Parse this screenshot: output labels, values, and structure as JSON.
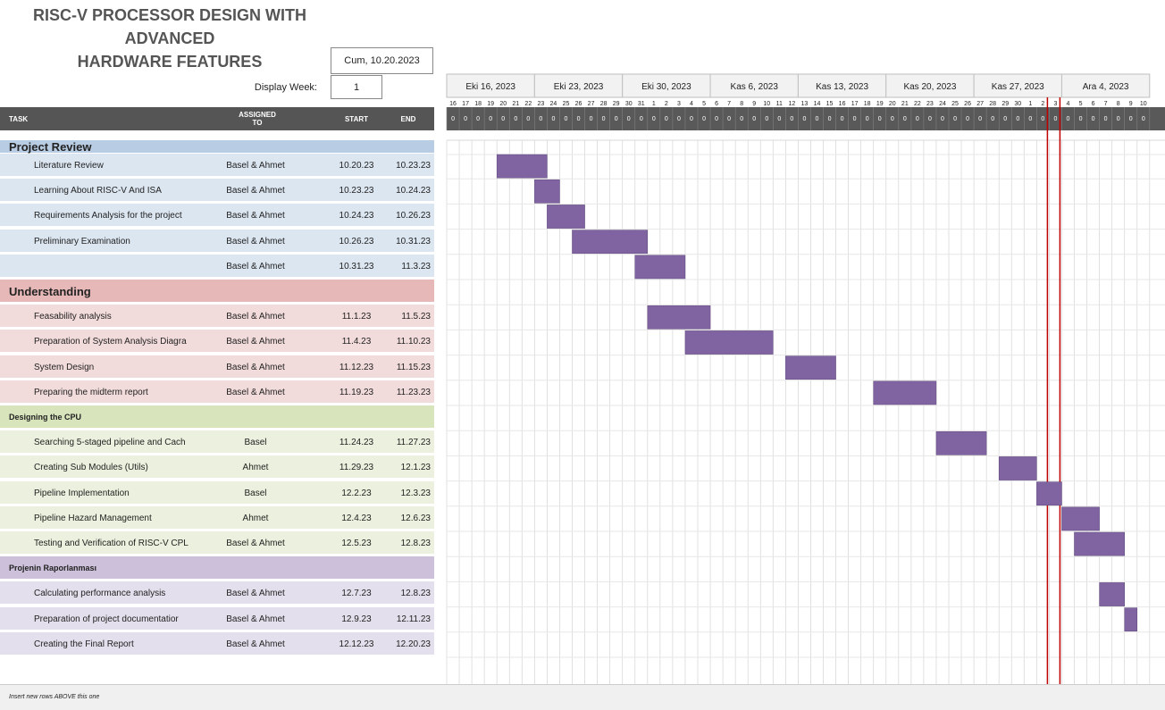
{
  "title": {
    "line1": "RISC-V PROCESSOR DESIGN WITH",
    "line2": "ADVANCED",
    "line3": "HARDWARE FEATURES"
  },
  "project_start": "Cum, 10.20.2023",
  "display_week": {
    "label": "Display Week:",
    "value": "1"
  },
  "headers": {
    "task": "TASK",
    "assigned_line1": "ASSIGNED",
    "assigned_line2": "TO",
    "start": "START",
    "end": "END"
  },
  "timeline": {
    "weeks": [
      "Eki 16, 2023",
      "Eki 23, 2023",
      "Eki 30, 2023",
      "Kas 6, 2023",
      "Kas 13, 2023",
      "Kas 20, 2023",
      "Kas 27, 2023",
      "Ara 4, 2023"
    ],
    "days": [
      "16",
      "17",
      "18",
      "19",
      "20",
      "21",
      "22",
      "23",
      "24",
      "25",
      "26",
      "27",
      "28",
      "29",
      "30",
      "31",
      "1",
      "2",
      "3",
      "4",
      "5",
      "6",
      "7",
      "8",
      "9",
      "10",
      "11",
      "12",
      "13",
      "14",
      "15",
      "16",
      "17",
      "18",
      "19",
      "20",
      "21",
      "22",
      "23",
      "24",
      "25",
      "26",
      "27",
      "28",
      "29",
      "30",
      "1",
      "2",
      "3",
      "4",
      "5",
      "6",
      "7",
      "8",
      "9",
      "10"
    ],
    "zero": "0",
    "today_markers": [
      3,
      4
    ]
  },
  "colors": {
    "bar": "#8064a2",
    "review_head": "#b8cce4",
    "review_row": "#dce6f1",
    "understanding_head": "#e6b8b7",
    "understanding_row": "#f2dcdb",
    "cpu_head": "#d8e4bc",
    "cpu_row": "#ebf1de",
    "report_head": "#ccc0da",
    "report_row": "#e4dfec",
    "today_line": "#c00000"
  },
  "sections": [
    {
      "name": "Project Review",
      "size": "big",
      "head_color": "review_head",
      "row_color": "review_row",
      "tasks": [
        {
          "task": "Literature Review",
          "assigned": "Basel & Ahmet",
          "start": "10.20.23",
          "end": "10.23.23",
          "bar": [
            4,
            8
          ]
        },
        {
          "task": "Learning About RISC-V And ISA",
          "assigned": "Basel & Ahmet",
          "start": "10.23.23",
          "end": "10.24.23",
          "bar": [
            7,
            9
          ]
        },
        {
          "task": "Requirements Analysis for the project",
          "assigned": "Basel & Ahmet",
          "start": "10.24.23",
          "end": "10.26.23",
          "bar": [
            8,
            11
          ]
        },
        {
          "task": "Preliminary Examination",
          "assigned": "Basel & Ahmet",
          "start": "10.26.23",
          "end": "10.31.23",
          "bar": [
            10,
            16
          ]
        },
        {
          "task": "",
          "assigned": "Basel & Ahmet",
          "start": "10.31.23",
          "end": "11.3.23",
          "bar": [
            15,
            19
          ]
        }
      ]
    },
    {
      "name": "Understanding",
      "size": "medium",
      "head_color": "understanding_head",
      "row_color": "understanding_row",
      "tasks": [
        {
          "task": "Feasability analysis",
          "assigned": "Basel & Ahmet",
          "start": "11.1.23",
          "end": "11.5.23",
          "bar": [
            16,
            21
          ]
        },
        {
          "task": "Preparation of System Analysis Diagra",
          "assigned": "Basel & Ahmet",
          "start": "11.4.23",
          "end": "11.10.23",
          "bar": [
            19,
            26
          ]
        },
        {
          "task": "System Design",
          "assigned": "Basel & Ahmet",
          "start": "11.12.23",
          "end": "11.15.23",
          "bar": [
            27,
            31
          ]
        },
        {
          "task": "Preparing the midterm report",
          "assigned": "Basel & Ahmet",
          "start": "11.19.23",
          "end": "11.23.23",
          "bar": [
            34,
            39
          ]
        }
      ]
    },
    {
      "name": "Designing the CPU",
      "size": "small",
      "head_color": "cpu_head",
      "row_color": "cpu_row",
      "tasks": [
        {
          "task": "Searching 5-staged pipeline and Cach",
          "assigned": "Basel",
          "start": "11.24.23",
          "end": "11.27.23",
          "bar": [
            39,
            43
          ]
        },
        {
          "task": "Creating Sub Modules (Utils)",
          "assigned": "Ahmet",
          "start": "11.29.23",
          "end": "12.1.23",
          "bar": [
            44,
            47
          ]
        },
        {
          "task": "Pipeline Implementation",
          "assigned": "Basel",
          "start": "12.2.23",
          "end": "12.3.23",
          "bar": [
            47,
            49
          ]
        },
        {
          "task": "Pipeline Hazard Management",
          "assigned": "Ahmet",
          "start": "12.4.23",
          "end": "12.6.23",
          "bar": [
            49,
            52
          ]
        },
        {
          "task": "Testing and Verification of RISC-V CPL",
          "assigned": "Basel & Ahmet",
          "start": "12.5.23",
          "end": "12.8.23",
          "bar": [
            50,
            54
          ]
        }
      ]
    },
    {
      "name": "Projenin Raporlanması",
      "size": "small",
      "head_color": "report_head",
      "row_color": "report_row",
      "tasks": [
        {
          "task": "Calculating performance analysis",
          "assigned": "Basel & Ahmet",
          "start": "12.7.23",
          "end": "12.8.23",
          "bar": [
            52,
            54
          ]
        },
        {
          "task": "Preparation of project documentatior",
          "assigned": "Basel & Ahmet",
          "start": "12.9.23",
          "end": "12.11.23",
          "bar": [
            54,
            55
          ]
        },
        {
          "task": "Creating the Final Report",
          "assigned": "Basel & Ahmet",
          "start": "12.12.23",
          "end": "12.20.23",
          "bar": null
        }
      ]
    }
  ],
  "footer": "Insert new rows ABOVE this one"
}
